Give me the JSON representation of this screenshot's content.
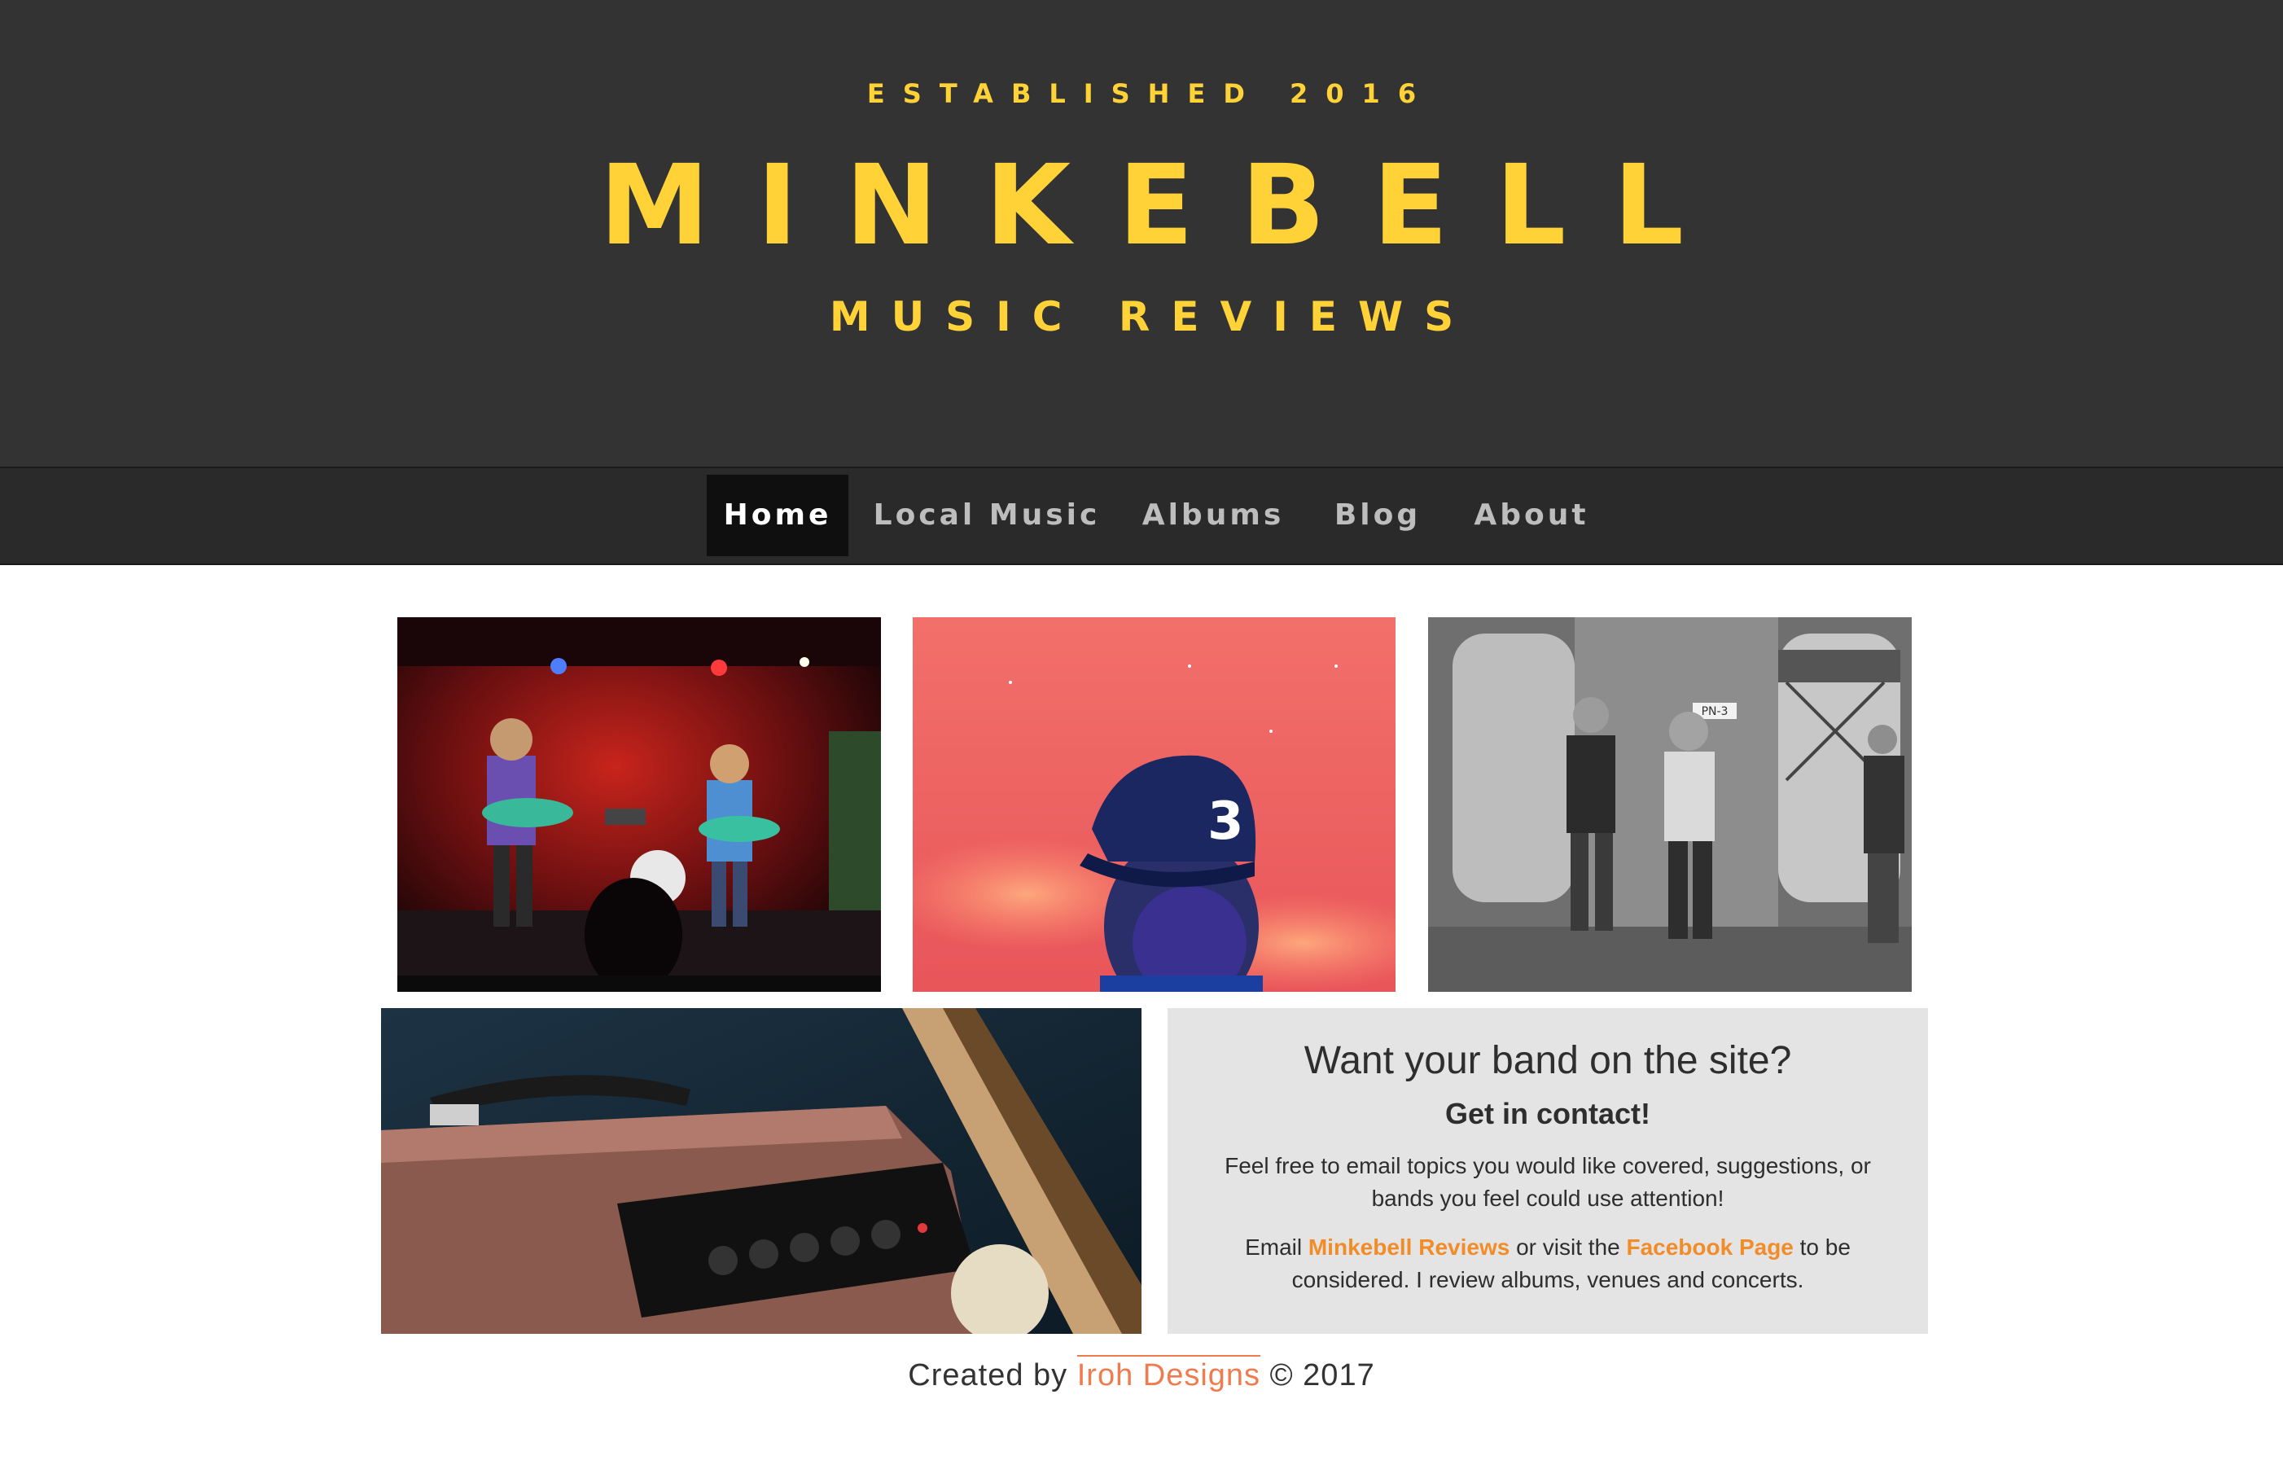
{
  "header": {
    "tagline": "ESTABLISHED 2016",
    "title": "MINKEBELL",
    "subtitle": "MUSIC REVIEWS"
  },
  "nav": {
    "items": [
      {
        "label": "Home",
        "active": true
      },
      {
        "label": "Local Music"
      },
      {
        "label": "Albums"
      },
      {
        "label": "Blog"
      },
      {
        "label": "About"
      }
    ]
  },
  "gallery": {
    "photo2_cap_number": "3",
    "photo3_sign": "PN-3"
  },
  "contact": {
    "heading": "Want your band on the site?",
    "subheading": "Get in contact!",
    "paragraph1": "Feel free to email topics you would like covered, suggestions, or bands you feel could use attention!",
    "p2_prefix": "Email ",
    "email_link": "Minkebell Reviews",
    "p2_middle": " or visit the ",
    "facebook_link": "Facebook Page",
    "p2_suffix": " to be considered. I review albums, venues and concerts."
  },
  "footer": {
    "prefix": "Created by ",
    "link": "Iroh Designs",
    "suffix": " © 2017"
  },
  "colors": {
    "header_bg": "#333333",
    "nav_bg": "#2a2a2a",
    "accent_yellow": "#ffd338",
    "link_orange": "#f28c28",
    "contact_bg": "#e4e4e4"
  }
}
